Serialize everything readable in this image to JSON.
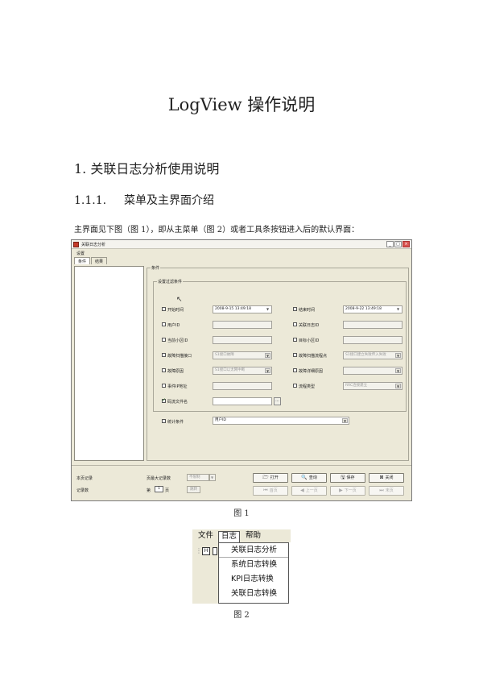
{
  "doc": {
    "title": "LogView 操作说明",
    "section1": "1. 关联日志分析使用说明",
    "subsection_num": "1.1.1.",
    "subsection_title": "菜单及主界面介绍",
    "intro": "主界面见下图（图 1），即从主菜单（图 2）或者工具条按钮进入后的默认界面：",
    "fig1_caption": "图 1",
    "fig2_caption": "图 2"
  },
  "fig1": {
    "window_title": "关联日志分析",
    "menu_settings": "设置",
    "tabs": [
      "条件",
      "结果"
    ],
    "cond_group": "条件",
    "filter_group": "设置过滤条件",
    "rows": {
      "start_time": {
        "label": "开始时间",
        "value": "2008-9-15 13:49:18"
      },
      "end_time": {
        "label": "结束时间",
        "value": "2008-9-22 13:49:18"
      },
      "user_id": {
        "label": "用户ID"
      },
      "assoc_log_id": {
        "label": "关联日志ID"
      },
      "cur_cell_id": {
        "label": "当前小区ID"
      },
      "target_cell_id": {
        "label": "目标小区ID"
      },
      "fault_trace_if": {
        "label": "故障扫描接口",
        "value": "S1接口故障"
      },
      "fault_trace_flow": {
        "label": "故障扫描流程点",
        "value": "S1接口建立失败传入失败"
      },
      "fault_cause": {
        "label": "故障原因",
        "value": "S1接口以太网中断"
      },
      "fault_detail": {
        "label": "故障详细原因"
      },
      "event_ip": {
        "label": "事件IP地址"
      },
      "flow_type": {
        "label": "流程类型",
        "value": "RRC连接建立"
      },
      "code_file": {
        "label": "码流文件名"
      },
      "stat_cond": {
        "label": "统计条件",
        "value": "用户ID"
      }
    },
    "bottom": {
      "page_records": "本页记录",
      "page_size_label": "页最大记录数",
      "page_size_value": "不限制",
      "records_label": "记录数",
      "page_prefix": "第",
      "page_value": "1",
      "page_suffix": "页",
      "jump": "跳转",
      "open": "打开",
      "query": "查询",
      "save": "保存",
      "close": "关闭",
      "first": "首页",
      "prev": "上一页",
      "next": "下一页",
      "last": "末页"
    }
  },
  "fig2": {
    "menus": [
      "文件",
      "日志",
      "帮助"
    ],
    "items": [
      "关联日志分析",
      "系统日志转换",
      "KPI日志转换",
      "关联日志转换"
    ]
  }
}
